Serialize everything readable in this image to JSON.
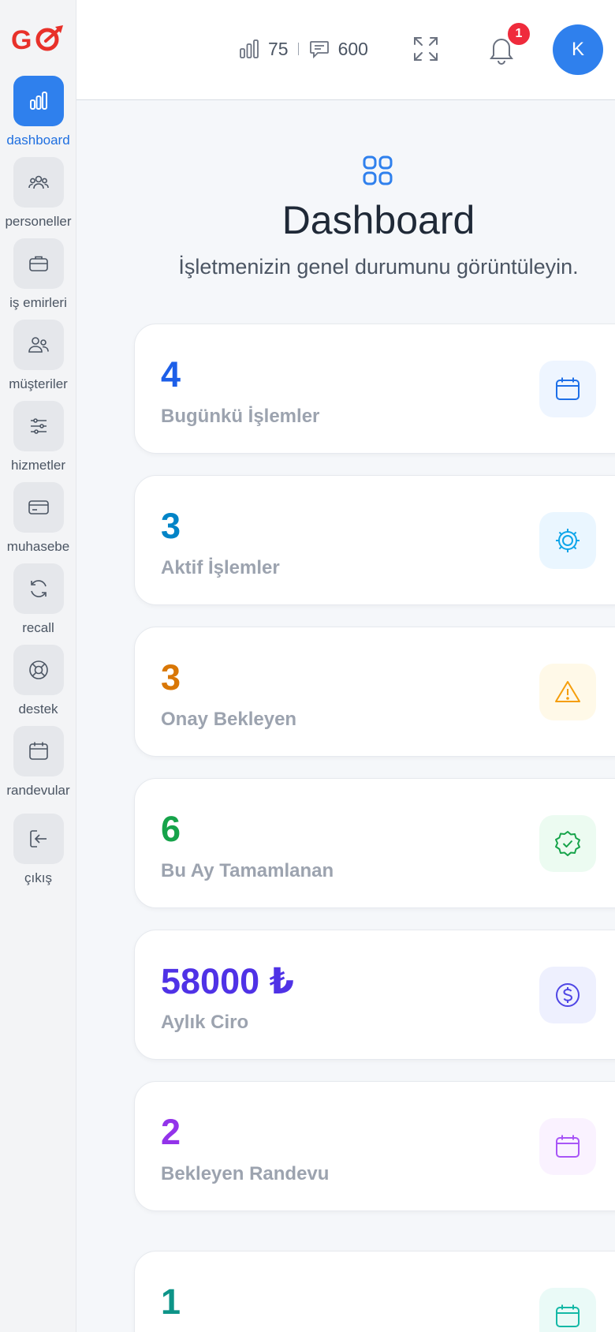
{
  "brand": {
    "logo_text": "GO"
  },
  "sidebar": {
    "items": [
      {
        "label": "dashboard",
        "icon": "bar-chart-icon"
      },
      {
        "label": "personeller",
        "icon": "users-group-icon"
      },
      {
        "label": "iş emirleri",
        "icon": "briefcase-icon"
      },
      {
        "label": "müşteriler",
        "icon": "users-icon"
      },
      {
        "label": "hizmetler",
        "icon": "sliders-icon"
      },
      {
        "label": "muhasebe",
        "icon": "credit-card-icon"
      },
      {
        "label": "recall",
        "icon": "refresh-icon"
      },
      {
        "label": "destek",
        "icon": "lifebuoy-icon"
      },
      {
        "label": "randevular",
        "icon": "calendar-icon"
      },
      {
        "label": "çıkış",
        "icon": "logout-icon"
      }
    ]
  },
  "header": {
    "stat_chart_count": "75",
    "stat_message_count": "600",
    "notification_count": "1",
    "avatar_initial": "K"
  },
  "page": {
    "title": "Dashboard",
    "subtitle": "İşletmenizin genel durumunu görüntüleyin."
  },
  "cards": [
    {
      "value": "4",
      "label": "Bugünkü İşlemler",
      "color": "#1d5fe8",
      "icon_bg": "#eef5ff",
      "icon": "calendar-icon"
    },
    {
      "value": "3",
      "label": "Aktif İşlemler",
      "color": "#0284c7",
      "icon_bg": "#eaf6ff",
      "icon": "gear-icon"
    },
    {
      "value": "3",
      "label": "Onay Bekleyen",
      "color": "#d97706",
      "icon_bg": "#fff9e8",
      "icon": "warning-icon"
    },
    {
      "value": "6",
      "label": "Bu Ay Tamamlanan",
      "color": "#16a34a",
      "icon_bg": "#ecfbf1",
      "icon": "check-badge-icon"
    },
    {
      "value": "58000 ₺",
      "label": "Aylık Ciro",
      "color": "#4f32e6",
      "icon_bg": "#eef0fe",
      "icon": "dollar-icon"
    },
    {
      "value": "2",
      "label": "Bekleyen Randevu",
      "color": "#9333ea",
      "icon_bg": "#faf2ff",
      "icon": "calendar-icon"
    },
    {
      "value": "1",
      "label": "",
      "color": "#0d9488",
      "icon_bg": "#eafaf7",
      "icon": "calendar-icon"
    }
  ]
}
